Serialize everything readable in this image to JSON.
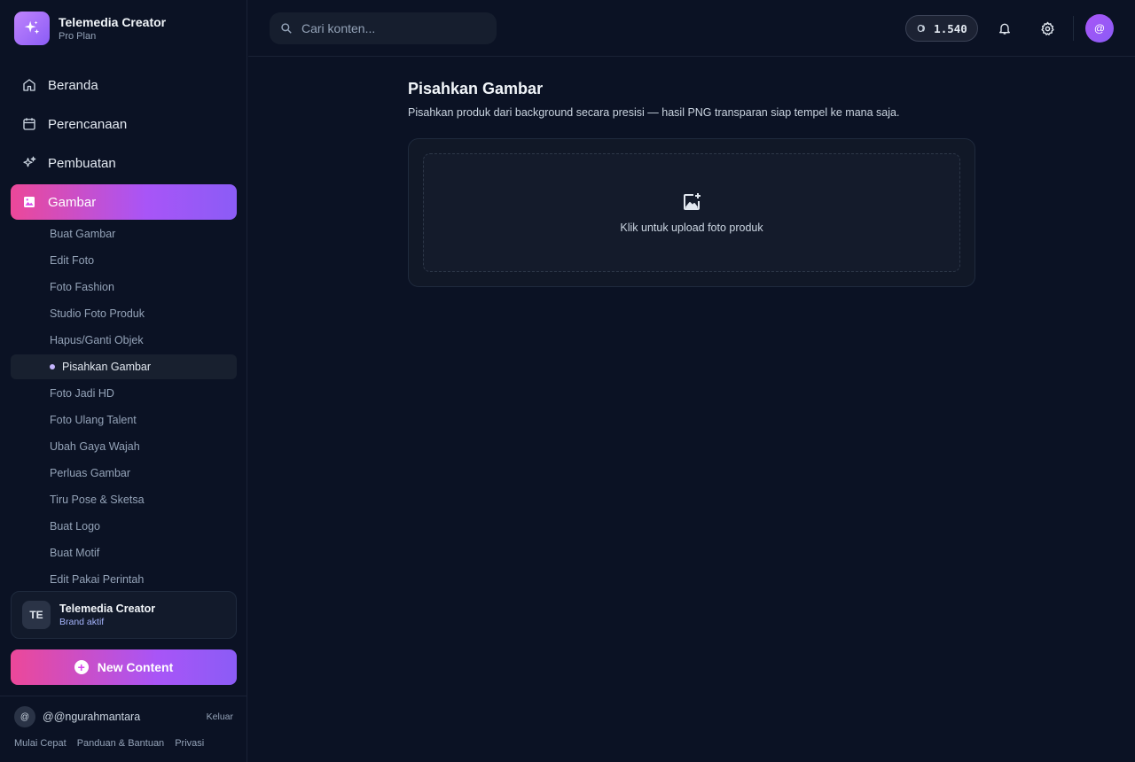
{
  "brand": {
    "name": "Telemedia Creator",
    "plan": "Pro Plan"
  },
  "nav": [
    {
      "label": "Beranda",
      "icon": "home-icon"
    },
    {
      "label": "Perencanaan",
      "icon": "calendar-icon"
    },
    {
      "label": "Pembuatan",
      "icon": "sparkles-icon"
    },
    {
      "label": "Gambar",
      "icon": "image-icon",
      "active": true
    }
  ],
  "subnav": [
    "Buat Gambar",
    "Edit Foto",
    "Foto Fashion",
    "Studio Foto Produk",
    "Hapus/Ganti Objek",
    "Pisahkan Gambar",
    "Foto Jadi HD",
    "Foto Ulang Talent",
    "Ubah Gaya Wajah",
    "Perluas Gambar",
    "Tiru Pose & Sketsa",
    "Buat Logo",
    "Buat Motif",
    "Edit Pakai Perintah"
  ],
  "subnav_active_index": 5,
  "brand_card": {
    "initials": "TE",
    "name": "Telemedia Creator",
    "status": "Brand aktif"
  },
  "new_content_label": "New Content",
  "user": {
    "avatar": "@",
    "handle": "@@ngurahmantara",
    "logout": "Keluar"
  },
  "footer_links": [
    "Mulai Cepat",
    "Panduan & Bantuan",
    "Privasi"
  ],
  "search": {
    "placeholder": "Cari konten..."
  },
  "credits": "1.540",
  "header_avatar": "@",
  "page": {
    "title": "Pisahkan Gambar",
    "description": "Pisahkan produk dari background secara presisi — hasil PNG transparan siap tempel ke mana saja.",
    "upload_label": "Klik untuk upload foto produk"
  },
  "colors": {
    "accent_pink": "#ec4899",
    "accent_purple": "#8b5cf6",
    "background": "#0b1224"
  }
}
